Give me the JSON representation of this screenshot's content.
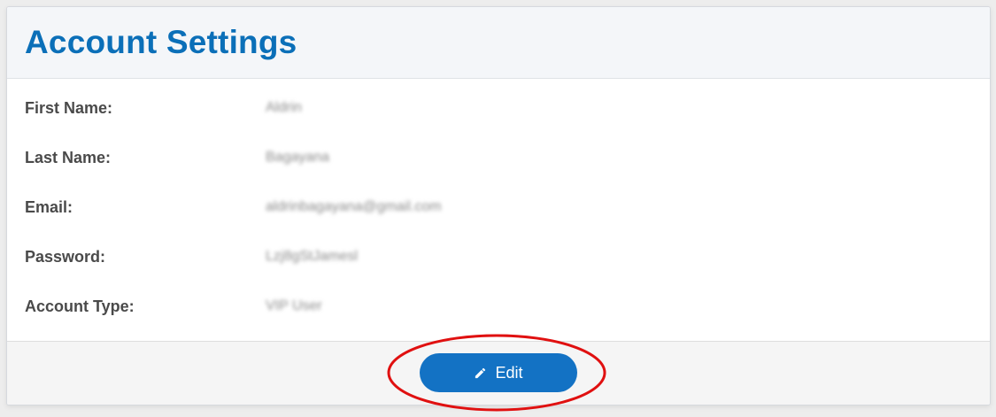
{
  "header": {
    "title": "Account Settings"
  },
  "fields": [
    {
      "label": "First Name:",
      "value": "Aldrin"
    },
    {
      "label": "Last Name:",
      "value": "Bagayana"
    },
    {
      "label": "Email:",
      "value": "aldrinbagayana@gmail.com"
    },
    {
      "label": "Password:",
      "value": "Lzj8gStJamesl"
    },
    {
      "label": "Account Type:",
      "value": "VIP User"
    }
  ],
  "footer": {
    "edit_label": "Edit",
    "edit_icon": "pencil-icon"
  },
  "colors": {
    "accent": "#0b6fb8",
    "button": "#1372c4",
    "annotation": "#e01010"
  }
}
